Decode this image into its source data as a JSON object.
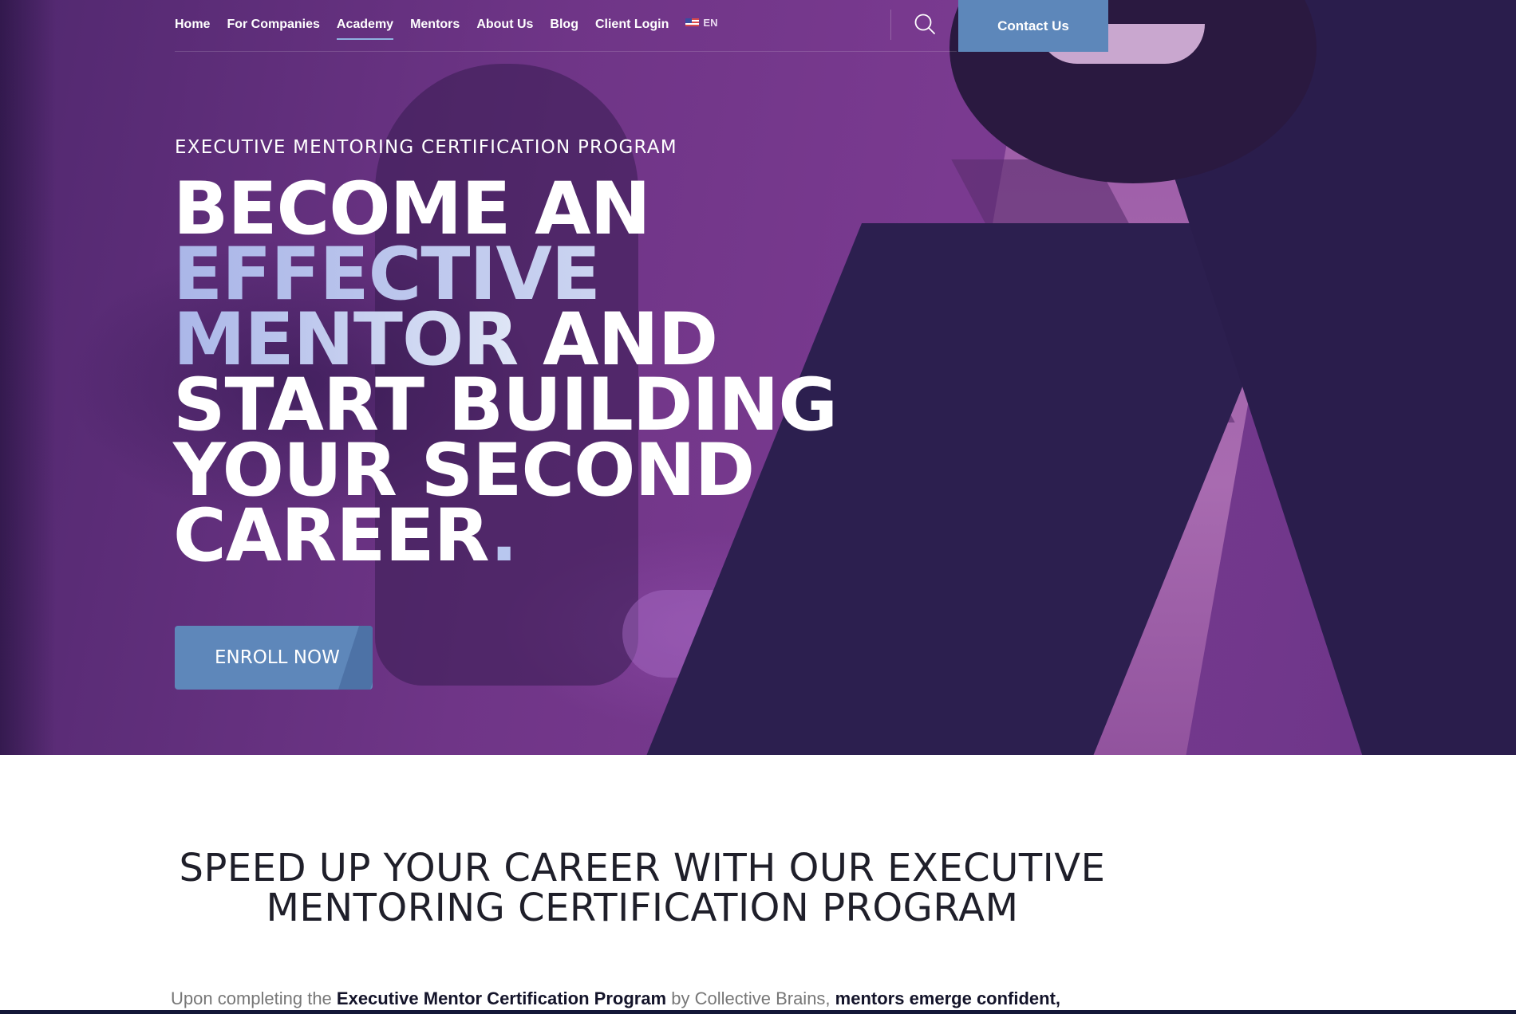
{
  "nav": {
    "items": [
      {
        "label": "Home",
        "active": false
      },
      {
        "label": "For Companies",
        "active": false
      },
      {
        "label": "Academy",
        "active": true
      },
      {
        "label": "Mentors",
        "active": false
      },
      {
        "label": "About Us",
        "active": false
      },
      {
        "label": "Blog",
        "active": false
      },
      {
        "label": "Client Login",
        "active": false
      }
    ],
    "language": "EN",
    "language_icon": "us-flag-icon",
    "search_icon": "search-icon",
    "contact_label": "Contact Us"
  },
  "hero": {
    "eyebrow": "EXECUTIVE MENTORING CERTIFICATION PROGRAM",
    "headline": {
      "line1": "BECOME AN",
      "line2_accent": "EFFECTIVE",
      "line3_accent": "MENTOR",
      "line3_rest": " AND",
      "line4": "START BUILDING",
      "line5": "YOUR SECOND",
      "line6": "CAREER",
      "line6_dot": "."
    },
    "cta_label": "ENROLL NOW"
  },
  "section": {
    "title_line1": "SPEED UP YOUR CAREER WITH OUR EXECUTIVE",
    "title_line2": "MENTORING CERTIFICATION PROGRAM",
    "intro_part1": "Upon completing the ",
    "intro_bold1": "Executive Mentor Certification Program",
    "intro_part2": " by Collective Brains, ",
    "intro_bold2": "mentors emerge confident,"
  },
  "colors": {
    "hero_purple": "#6f3587",
    "accent_blue": "#5d87ba",
    "headline_accent": "#c5cff0",
    "heading_dark": "#1f1f2a"
  }
}
